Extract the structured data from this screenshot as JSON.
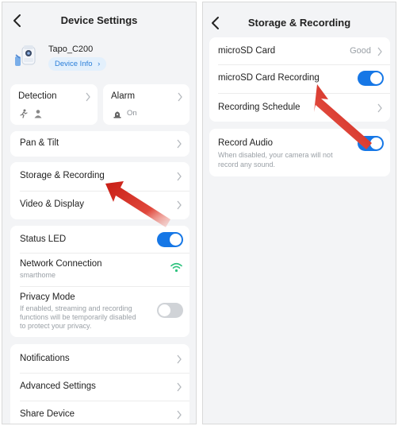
{
  "left_screen": {
    "title": "Device Settings",
    "device": {
      "name": "Tapo_C200",
      "info_button": "Device Info"
    },
    "detection": {
      "label": "Detection"
    },
    "alarm": {
      "label": "Alarm",
      "status": "On"
    },
    "pan_tilt": {
      "label": "Pan & Tilt"
    },
    "storage": {
      "label": "Storage & Recording"
    },
    "video": {
      "label": "Video & Display"
    },
    "status_led": {
      "label": "Status LED",
      "enabled": true
    },
    "network": {
      "label": "Network Connection",
      "ssid": "smarthome"
    },
    "privacy": {
      "label": "Privacy Mode",
      "description_1": "If enabled, streaming and recording",
      "description_2": "functions will be temporarily disabled",
      "description_3": "to protect your privacy.",
      "enabled": false
    },
    "notifications": {
      "label": "Notifications"
    },
    "advanced": {
      "label": "Advanced Settings"
    },
    "share": {
      "label": "Share Device"
    }
  },
  "right_screen": {
    "title": "Storage & Recording",
    "microsd_card": {
      "label": "microSD Card",
      "status": "Good"
    },
    "microsd_recording": {
      "label": "microSD Card Recording",
      "enabled": true
    },
    "recording_schedule": {
      "label": "Recording Schedule"
    },
    "record_audio": {
      "label": "Record Audio",
      "description_1": "When disabled, your camera will not",
      "description_2": "record any sound.",
      "enabled": true
    }
  },
  "colors": {
    "toggle_on": "#1677e6",
    "toggle_off": "#d0d3d7",
    "annotation_arrow": "#d9261c",
    "wifi_icon": "#2ec27e"
  }
}
